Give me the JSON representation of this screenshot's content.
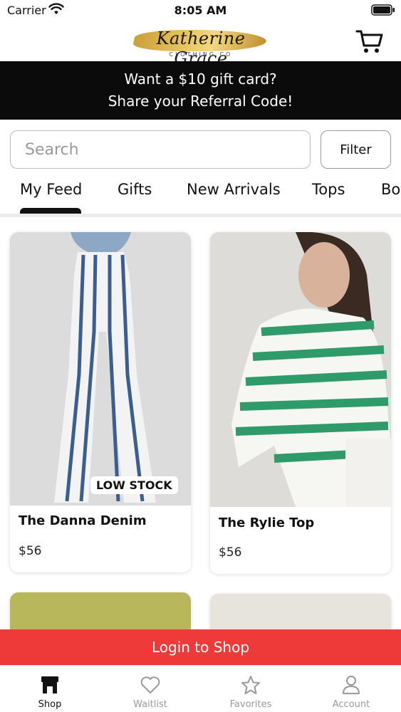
{
  "status_bar": {
    "carrier": "Carrier",
    "time": "8:05 AM"
  },
  "header": {
    "logo_script": "Katherine Grace",
    "logo_sub": "CLOTHING CO",
    "cart_icon": "shopping-cart-icon"
  },
  "promo": {
    "line1": "Want a $10 gift card?",
    "line2": "Share your Referral Code!"
  },
  "search": {
    "placeholder": "Search",
    "value": ""
  },
  "filter": {
    "label": "Filter"
  },
  "tabs": [
    {
      "label": "My Feed",
      "active": true
    },
    {
      "label": "Gifts"
    },
    {
      "label": "New Arrivals"
    },
    {
      "label": "Tops"
    },
    {
      "label": "Bottoms"
    }
  ],
  "products": [
    {
      "name": "The Danna Denim",
      "price": "$56",
      "badge": "LOW STOCK"
    },
    {
      "name": "The Rylie Top",
      "price": "$56"
    }
  ],
  "login_bar": {
    "label": "Login to Shop"
  },
  "bottom_nav": {
    "items": [
      {
        "label": "Shop",
        "icon": "storefront-icon",
        "active": true
      },
      {
        "label": "Waitlist",
        "icon": "heart-icon"
      },
      {
        "label": "Favorites",
        "icon": "star-icon"
      },
      {
        "label": "Account",
        "icon": "person-icon"
      }
    ]
  },
  "colors": {
    "promo_background": "#0b0b0b",
    "login_bar": "#ee3a38",
    "accent_gold": "#e7c35a"
  }
}
